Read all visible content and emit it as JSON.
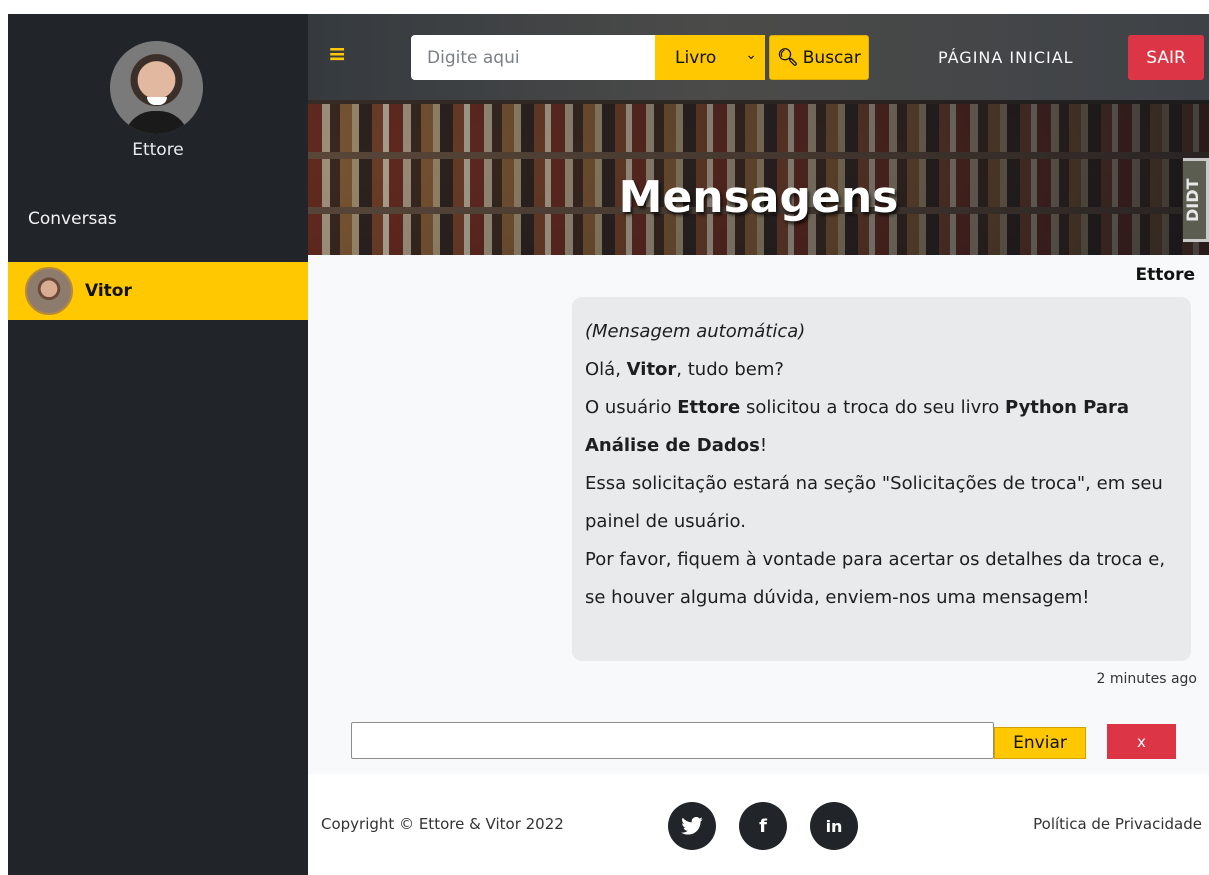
{
  "sidebar": {
    "user_name": "Ettore",
    "section_title": "Conversas",
    "conversations": [
      {
        "name": "Vitor"
      }
    ]
  },
  "nav": {
    "menu_icon": "≡",
    "search_placeholder": "Digite aqui",
    "search_type_selected": "Livro",
    "search_button_label": "Buscar",
    "home_label": "PÁGINA INICIAL",
    "exit_label": "SAIR"
  },
  "banner": {
    "title": "Mensagens",
    "badge_text": "DIDT"
  },
  "chat": {
    "sender": "Ettore",
    "message": {
      "line1": "(Mensagem automática)",
      "line2_pre": "Olá, ",
      "line2_name": "Vitor",
      "line2_post": ", tudo bem?",
      "line3_pre": "O usuário ",
      "line3_user": "Ettore",
      "line3_mid": " solicitou a troca do seu livro ",
      "line3_book": "Python Para Análise de Dados",
      "line3_post": "!",
      "line4": "Essa solicitação estará na seção \"Solicitações de troca\", em seu painel de usuário.",
      "line5": "Por favor, fiquem à vontade para acertar os detalhes da troca e, se houver alguma dúvida, enviem-nos uma mensagem!"
    },
    "timestamp": "2 minutes ago",
    "input_value": "",
    "send_label": "Enviar",
    "close_label": "x"
  },
  "footer": {
    "copyright": "Copyright © Ettore & Vitor 2022",
    "social": [
      {
        "icon": "twitter-icon",
        "glyph": "🐦"
      },
      {
        "icon": "facebook-icon",
        "glyph": "f"
      },
      {
        "icon": "linkedin-icon",
        "glyph": "in"
      }
    ],
    "privacy_label": "Política de Privacidade"
  },
  "colors": {
    "accent": "#ffc800",
    "sidebar": "#212529",
    "danger": "#dc3545"
  }
}
